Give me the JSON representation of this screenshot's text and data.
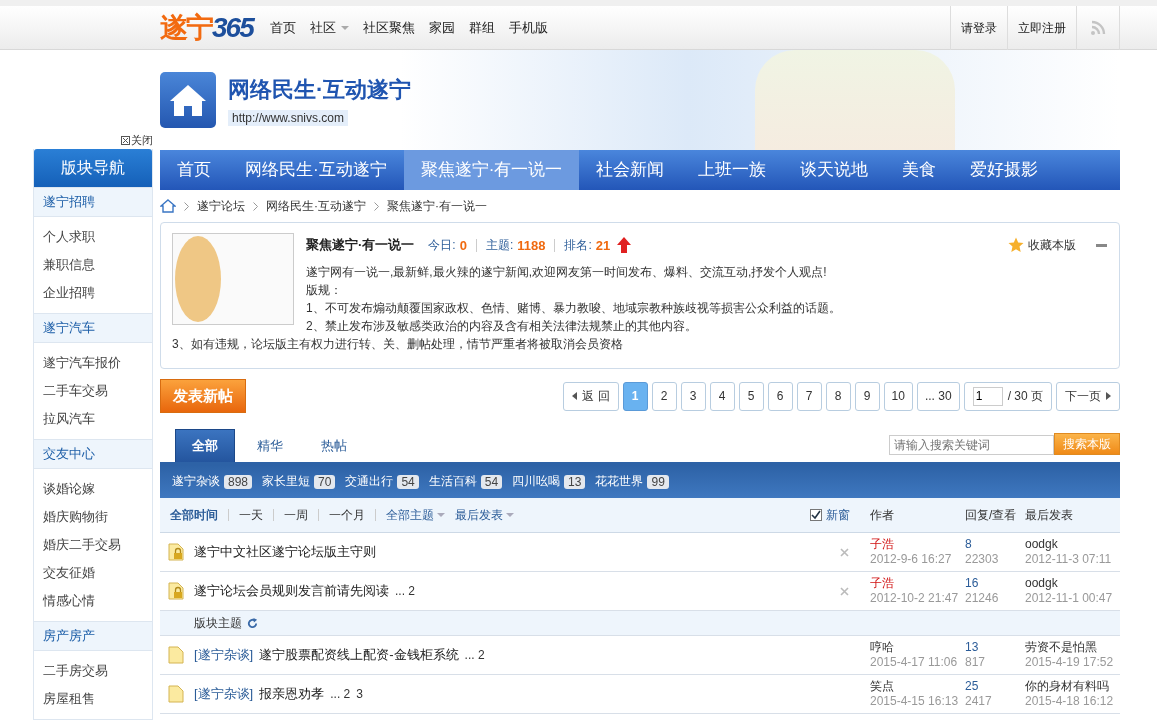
{
  "top_bar": {
    "logo": {
      "part_1": "遂宁",
      "part_2": "365"
    },
    "menu": [
      {
        "label": "首页",
        "has_menu": false
      },
      {
        "label": "社区",
        "has_menu": true
      },
      {
        "label": "社区聚焦",
        "has_menu": false
      },
      {
        "label": "家园",
        "has_menu": false
      },
      {
        "label": "群组",
        "has_menu": false
      },
      {
        "label": "手机版",
        "has_menu": false
      }
    ],
    "user_links": [
      "请登录",
      "立即注册"
    ]
  },
  "banner": {
    "title": "网络民生·互动遂宁",
    "url": "http://www.snivs.com"
  },
  "sidebar": {
    "close_label": "关闭",
    "title": "版块导航",
    "groups": [
      {
        "name": "遂宁招聘",
        "items": [
          "个人求职",
          "兼职信息",
          "企业招聘"
        ]
      },
      {
        "name": "遂宁汽车",
        "items": [
          "遂宁汽车报价",
          "二手车交易",
          "拉风汽车"
        ]
      },
      {
        "name": "交友中心",
        "items": [
          "谈婚论嫁",
          "婚庆购物街",
          "婚庆二手交易",
          "交友征婚",
          "情感心情"
        ]
      },
      {
        "name": "房产房产",
        "items": [
          "二手房交易",
          "房屋租售"
        ]
      }
    ]
  },
  "nav": [
    {
      "label": "首页",
      "selected": false
    },
    {
      "label": "网络民生·互动遂宁",
      "selected": false
    },
    {
      "label": "聚焦遂宁·有一说一",
      "selected": true
    },
    {
      "label": "社会新闻",
      "selected": false
    },
    {
      "label": "上班一族",
      "selected": false
    },
    {
      "label": "谈天说地",
      "selected": false
    },
    {
      "label": "美食",
      "selected": false
    },
    {
      "label": "爱好摄影",
      "selected": false
    }
  ],
  "breadcrumb": [
    "遂宁论坛",
    "网络民生·互动遂宁",
    "聚焦遂宁·有一说一"
  ],
  "forum_info": {
    "name": "聚焦遂宁·有一说一",
    "stats": [
      {
        "label": "今日:",
        "value": "0"
      },
      {
        "label": "主题:",
        "value": "1188"
      },
      {
        "label": "排名:",
        "value": "21"
      }
    ],
    "favorite_label": "收藏本版",
    "rules": [
      "遂宁网有一说一,最新鲜,最火辣的遂宁新闻,欢迎网友第一时间发布、爆料、交流互动,抒发个人观点!",
      "版规：",
      "1、不可发布煽动颠覆国家政权、色情、赌博、暴力教唆、地域宗教种族歧视等损害公众利益的话题。",
      "2、禁止发布涉及敏感类政治的内容及含有相关法律法规禁止的其他内容。",
      "3、如有违规，论坛版主有权力进行转、关、删帖处理，情节严重者将被取消会员资格"
    ]
  },
  "new_post_button": "发表新帖",
  "pagination": {
    "back_label": "返 回",
    "pages": [
      {
        "label": "1",
        "selected": true
      },
      {
        "label": "2",
        "selected": false
      },
      {
        "label": "3",
        "selected": false
      },
      {
        "label": "4",
        "selected": false
      },
      {
        "label": "5",
        "selected": false
      },
      {
        "label": "6",
        "selected": false
      },
      {
        "label": "7",
        "selected": false
      },
      {
        "label": "8",
        "selected": false
      },
      {
        "label": "9",
        "selected": false
      },
      {
        "label": "10",
        "selected": false
      },
      {
        "label": "... 30",
        "selected": false
      }
    ],
    "page_input": "1",
    "total_label": "/ 30 页",
    "next_label": "下一页"
  },
  "tabs": [
    {
      "label": "全部",
      "selected": true
    },
    {
      "label": "精华",
      "selected": false
    },
    {
      "label": "热帖",
      "selected": false
    }
  ],
  "search": {
    "placeholder": "请输入搜索关键词",
    "button": "搜索本版"
  },
  "categories": [
    {
      "name": "遂宁杂谈",
      "count": "898"
    },
    {
      "name": "家长里短",
      "count": "70"
    },
    {
      "name": "交通出行",
      "count": "54"
    },
    {
      "name": "生活百科",
      "count": "54"
    },
    {
      "name": "四川吆喝",
      "count": "13"
    },
    {
      "name": "花花世界",
      "count": "99"
    }
  ],
  "filters": [
    {
      "label": "全部时间",
      "selected": true,
      "has_menu": false
    },
    {
      "label": "一天",
      "selected": false,
      "has_menu": false
    },
    {
      "label": "一周",
      "selected": false,
      "has_menu": false
    },
    {
      "label": "一个月",
      "selected": false,
      "has_menu": false
    },
    {
      "label": "全部主题",
      "selected": false,
      "has_menu": true
    },
    {
      "label": "最后发表",
      "selected": false,
      "has_menu": true
    }
  ],
  "new_window": {
    "label": "新窗",
    "checked": true
  },
  "columns": {
    "author": "作者",
    "replies_views": "回复/查看",
    "last_post": "最后发表"
  },
  "threads": [
    {
      "kind": "sticky",
      "title": "遂宁中文社区遂宁论坛版主守则",
      "author": "子浩",
      "date": "2012-9-6 16:27",
      "replies": "8",
      "views": "22303",
      "last_user": "oodgk",
      "last_date": "2012-11-3 07:11"
    },
    {
      "kind": "sticky",
      "title": "遂宁论坛会员规则发言前请先阅读",
      "pages": [
        "... 2"
      ],
      "author": "子浩",
      "date": "2012-10-2 21:47",
      "replies": "16",
      "views": "21246",
      "last_user": "oodgk",
      "last_date": "2012-11-1 00:47"
    },
    {
      "kind": "separator",
      "title": "版块主题"
    },
    {
      "kind": "normal",
      "category": "[遂宁杂谈]",
      "title": "遂宁股票配资线上配资-金钱柜系统",
      "pages": [
        "... 2"
      ],
      "author": "哼哈",
      "date": "2015-4-17 11:06",
      "replies": "13",
      "views": "817",
      "last_user": "劳资不是怕黑",
      "last_date": "2015-4-19 17:52"
    },
    {
      "kind": "normal",
      "category": "[遂宁杂谈]",
      "title": "报亲恩劝孝",
      "pages": [
        "... 2",
        "3"
      ],
      "author": "笑点",
      "date": "2015-4-15 16:13",
      "replies": "25",
      "views": "2417",
      "last_user": "你的身材有料吗",
      "last_date": "2015-4-18 16:12"
    }
  ]
}
